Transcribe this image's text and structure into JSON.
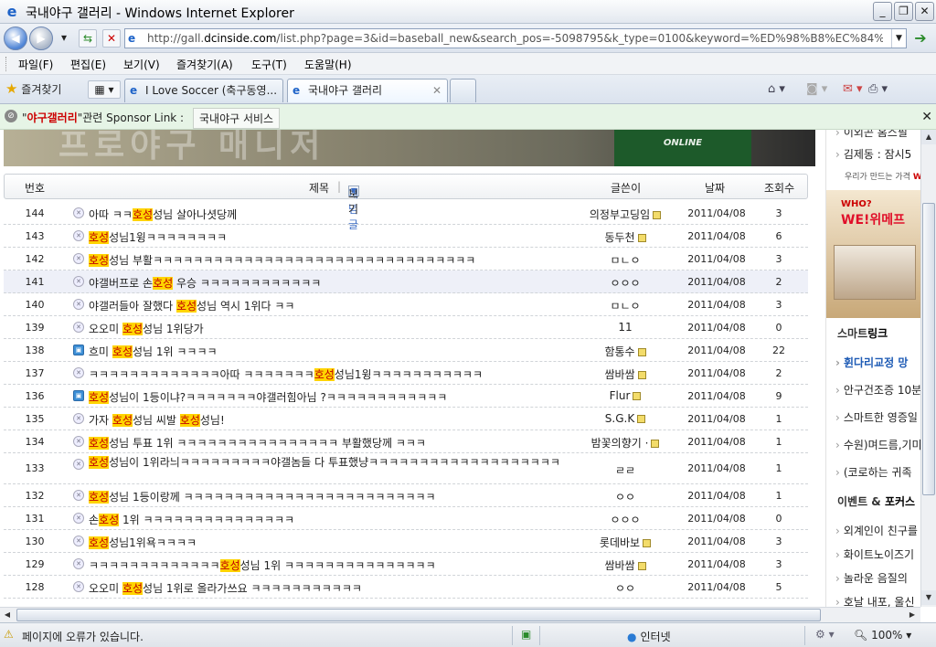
{
  "window": {
    "title": "국내야구 갤러리 - Windows Internet Explorer",
    "buttons": [
      "_",
      "❐",
      "✕"
    ]
  },
  "address": {
    "url_prefix": "http://gall.",
    "url_domain": "dcinside.com",
    "url_rest": "/list.php?page=3&id=baseball_new&search_pos=-5098795&k_type=0100&keyword=%ED%98%B8%EC%84%B1"
  },
  "menu": [
    "파일(F)",
    "편집(E)",
    "보기(V)",
    "즐겨찾기(A)",
    "도구(T)",
    "도움말(H)"
  ],
  "tabs": {
    "favorites": "즐겨찾기",
    "items": [
      {
        "label": "I Love Soccer (축구동영..."
      },
      {
        "label": "국내야구 갤러리"
      }
    ]
  },
  "sponsor": {
    "open_quote": "\"",
    "highlight": "야구갤러리",
    "close_text": "\"관련 Sponsor Link :",
    "button": "국내야구 서비스"
  },
  "banner": {
    "left_text": "프로야구 매니저",
    "right_text": "ONLINE"
  },
  "list": {
    "headers": {
      "num": "번호",
      "subject": "제목",
      "concept": "개념글",
      "concept_view": "보기",
      "writer": "글쓴이",
      "date": "날짜",
      "views": "조회수"
    },
    "rows": [
      {
        "num": "144",
        "pre": "아따 ㅋㅋ",
        "kw": "호성",
        "post": "성님 살아나셧당께",
        "writer": "의정부고딩임",
        "lock": true,
        "date": "2011/04/08",
        "views": "3",
        "pic": false
      },
      {
        "num": "143",
        "pre": "",
        "kw": "호성",
        "post": "성님1윙ㅋㅋㅋㅋㅋㅋㅋㅋ",
        "writer": "동두천",
        "lock": true,
        "date": "2011/04/08",
        "views": "6",
        "pic": false
      },
      {
        "num": "142",
        "pre": "",
        "kw": "호성",
        "post": "성님 부활ㅋㅋㅋㅋㅋㅋㅋㅋㅋㅋㅋㅋㅋㅋㅋㅋㅋㅋㅋㅋㅋㅋㅋㅋㅋㅋㅋㅋㅋㅋㅋㅋ",
        "writer": "ㅁㄴㅇ",
        "lock": false,
        "date": "2011/04/08",
        "views": "3",
        "pic": false
      },
      {
        "num": "141",
        "pre": "야갤버프로 손",
        "kw": "호성",
        "post": " 우승 ㅋㅋㅋㅋㅋㅋㅋㅋㅋㅋㅋㅋ",
        "writer": "ㅇㅇㅇ",
        "lock": false,
        "date": "2011/04/08",
        "views": "2",
        "pic": false,
        "hl": true
      },
      {
        "num": "140",
        "pre": "야갤러들아 잘했다 ",
        "kw": "호성",
        "post": "성님 역시 1위다 ㅋㅋ",
        "writer": "ㅁㄴㅇ",
        "lock": false,
        "date": "2011/04/08",
        "views": "3",
        "pic": false
      },
      {
        "num": "139",
        "pre": "오오미 ",
        "kw": "호성",
        "post": "성님 1위당가",
        "writer": "11",
        "lock": false,
        "date": "2011/04/08",
        "views": "0",
        "pic": false
      },
      {
        "num": "138",
        "pre": "흐미 ",
        "kw": "호성",
        "post": "성님 1위 ㅋㅋㅋㅋ",
        "writer": "함통수",
        "lock": true,
        "date": "2011/04/08",
        "views": "22",
        "pic": true
      },
      {
        "num": "137",
        "pre": "ㅋㅋㅋㅋㅋㅋㅋㅋㅋㅋㅋㅋㅋ아따 ㅋㅋㅋㅋㅋㅋㅋ",
        "kw": "호성",
        "post": "성님1윙ㅋㅋㅋㅋㅋㅋㅋㅋㅋㅋㅋ",
        "writer": "쌈바쌈",
        "lock": true,
        "date": "2011/04/08",
        "views": "2",
        "pic": false
      },
      {
        "num": "136",
        "pre": "",
        "kw": "호성",
        "post": "성님이 1등이냐?ㅋㅋㅋㅋㅋㅋㅋ야갤러힘아님 ?ㅋㅋㅋㅋㅋㅋㅋㅋㅋㅋㅋㅋ",
        "writer": "Flur",
        "lock": true,
        "date": "2011/04/08",
        "views": "9",
        "pic": true
      },
      {
        "num": "135",
        "pre": "가자 ",
        "kw": "호성",
        "post": "성님 씨발 ",
        "kw2": "호성",
        "post2": "성님!",
        "writer": "S.G.K",
        "lock": true,
        "date": "2011/04/08",
        "views": "1",
        "pic": false
      },
      {
        "num": "134",
        "pre": "",
        "kw": "호성",
        "post": "성님 투표 1위 ㅋㅋㅋㅋㅋㅋㅋㅋㅋㅋㅋㅋㅋㅋㅋㅋ 부활했당께 ㅋㅋㅋ",
        "writer": "밤꽃의향기 ·",
        "lock": true,
        "date": "2011/04/08",
        "views": "1",
        "pic": false
      },
      {
        "num": "133",
        "pre": "",
        "kw": "호성",
        "post": "성님이 1위라늬ㅋㅋㅋㅋㅋㅋㅋㅋㅋ야갤놈들 다 투표했냥ㅋㅋㅋㅋㅋㅋㅋㅋㅋㅋㅋㅋㅋㅋㅋㅋㅋㅋㅋ",
        "writer": "ㄹㄹ",
        "lock": false,
        "date": "2011/04/08",
        "views": "1",
        "pic": false,
        "tall": true
      },
      {
        "num": "132",
        "pre": "",
        "kw": "호성",
        "post": "성님 1등이랑께 ㅋㅋㅋㅋㅋㅋㅋㅋㅋㅋㅋㅋㅋㅋㅋㅋㅋㅋㅋㅋㅋㅋㅋㅋㅋ",
        "writer": "ㅇㅇ",
        "lock": false,
        "date": "2011/04/08",
        "views": "1",
        "pic": false
      },
      {
        "num": "131",
        "pre": "손",
        "kw": "호성",
        "post": " 1위 ㅋㅋㅋㅋㅋㅋㅋㅋㅋㅋㅋㅋㅋㅋㅋ",
        "writer": "ㅇㅇㅇ",
        "lock": false,
        "date": "2011/04/08",
        "views": "0",
        "pic": false
      },
      {
        "num": "130",
        "pre": "",
        "kw": "호성",
        "post": "성님1위욕ㅋㅋㅋㅋ",
        "writer": "롯데바보",
        "lock": true,
        "date": "2011/04/08",
        "views": "3",
        "pic": false
      },
      {
        "num": "129",
        "pre": "ㅋㅋㅋㅋㅋㅋㅋㅋㅋㅋㅋㅋㅋ",
        "kw": "호성",
        "post": "성님 1위 ㅋㅋㅋㅋㅋㅋㅋㅋㅋㅋㅋㅋㅋㅋㅋ",
        "writer": "쌈바쌈",
        "lock": true,
        "date": "2011/04/08",
        "views": "3",
        "pic": false
      },
      {
        "num": "128",
        "pre": "오오미 ",
        "kw": "호성",
        "post": "성님 1위로 올라가쓰요 ㅋㅋㅋㅋㅋㅋㅋㅋㅋㅋㅋ",
        "writer": "ㅇㅇ",
        "lock": false,
        "date": "2011/04/08",
        "views": "5",
        "pic": false
      }
    ]
  },
  "sidebar": {
    "top_items": [
      "이외곤 홈스필",
      "김제동 : 잠시5"
    ],
    "ad_line_pre": "우리가 만드는 가격 ",
    "ad_line_brand": "WI",
    "ad_who": "WHO?",
    "ad_we": "WE!위메프",
    "smart_title_pre": "스마트",
    "smart_title_em": "링크",
    "smart_items": [
      "휜다리교정 망",
      "안구건조증 10분",
      "스마트한 영증일",
      "수원)며드름,기미",
      "(코로하는 귀족"
    ],
    "event_title_pre": "이벤트 & ",
    "event_title_em": "포커스",
    "event_items": [
      "외계인이 친구를",
      "화이트노이즈기",
      "놀라운 음질의",
      "호날 내포, 울신"
    ]
  },
  "status": {
    "message": "페이지에 오류가 있습니다.",
    "zone": "인터넷",
    "zoom": "100%"
  }
}
